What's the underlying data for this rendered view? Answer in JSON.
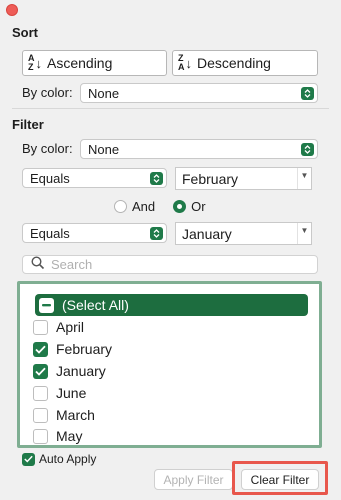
{
  "window": {
    "close_color": "#ee5c57"
  },
  "sort": {
    "title": "Sort",
    "ascending_label": "Ascending",
    "descending_label": "Descending",
    "by_color_label": "By color:",
    "by_color_value": "None"
  },
  "filter": {
    "title": "Filter",
    "by_color_label": "By color:",
    "by_color_value": "None",
    "condition1": {
      "operator": "Equals",
      "value": "February"
    },
    "logic": {
      "and_label": "And",
      "or_label": "Or",
      "selected": "Or"
    },
    "condition2": {
      "operator": "Equals",
      "value": "January"
    }
  },
  "search": {
    "placeholder": "Search",
    "value": ""
  },
  "list": {
    "items": [
      {
        "label": "(Select All)",
        "state": "mixed",
        "highlighted": true
      },
      {
        "label": "April",
        "state": "unchecked"
      },
      {
        "label": "February",
        "state": "checked"
      },
      {
        "label": "January",
        "state": "checked"
      },
      {
        "label": "June",
        "state": "unchecked"
      },
      {
        "label": "March",
        "state": "unchecked"
      },
      {
        "label": "May",
        "state": "unchecked"
      }
    ]
  },
  "auto_apply": {
    "label": "Auto Apply",
    "checked": true
  },
  "buttons": {
    "apply_label": "Apply Filter",
    "clear_label": "Clear Filter"
  },
  "colors": {
    "accent": "#1f7a49",
    "highlight_border": "#e8574c",
    "list_border": "#7fae92"
  }
}
